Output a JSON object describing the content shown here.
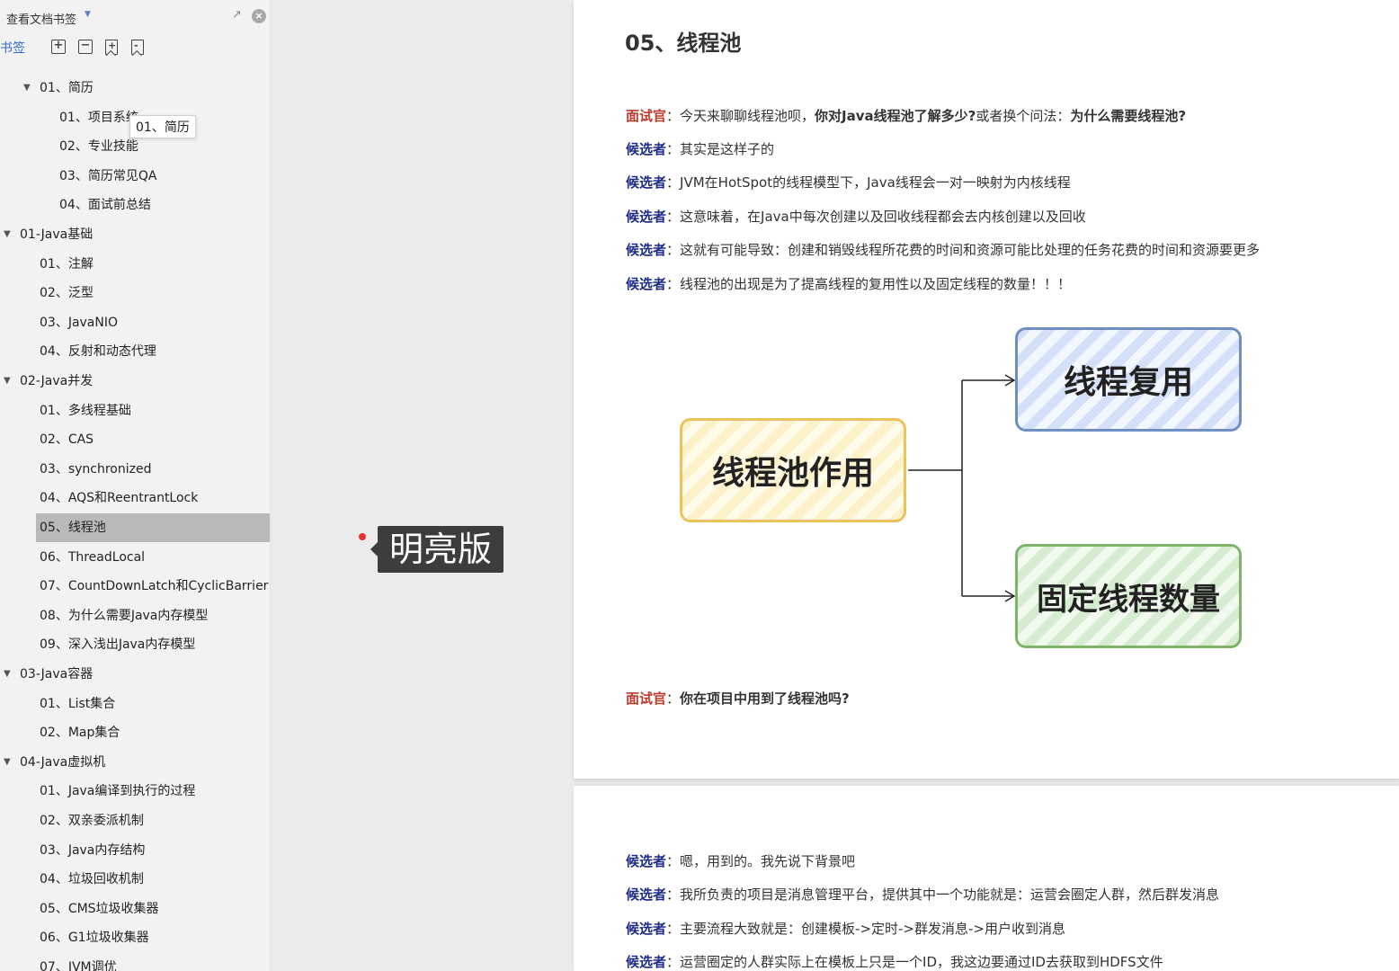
{
  "sidebar": {
    "title": "查看文档书签",
    "caret": "▼",
    "bookmarks_label": "书签",
    "tree": [
      {
        "label": "01、简历",
        "level": 1,
        "arrow": "▼"
      },
      {
        "label": "01、项目系统",
        "level": 2
      },
      {
        "label": "02、专业技能",
        "level": 2
      },
      {
        "label": "03、简历常见QA",
        "level": 2
      },
      {
        "label": "04、面试前总结",
        "level": 2
      },
      {
        "label": "01-Java基础",
        "level": 0,
        "arrow": "▼"
      },
      {
        "label": "01、注解",
        "level": 1
      },
      {
        "label": "02、泛型",
        "level": 1
      },
      {
        "label": "03、JavaNIO",
        "level": 1
      },
      {
        "label": "04、反射和动态代理",
        "level": 1
      },
      {
        "label": "02-Java并发",
        "level": 0,
        "arrow": "▼"
      },
      {
        "label": "01、多线程基础",
        "level": 1
      },
      {
        "label": "02、CAS",
        "level": 1
      },
      {
        "label": "03、synchronized",
        "level": 1
      },
      {
        "label": "04、AQS和ReentrantLock",
        "level": 1
      },
      {
        "label": "05、线程池",
        "level": 1,
        "selected": true
      },
      {
        "label": "06、ThreadLocal",
        "level": 1
      },
      {
        "label": "07、CountDownLatch和CyclicBarrier",
        "level": 1
      },
      {
        "label": "08、为什么需要Java内存模型",
        "level": 1
      },
      {
        "label": "09、深入浅出Java内存模型",
        "level": 1
      },
      {
        "label": "03-Java容器",
        "level": 0,
        "arrow": "▼"
      },
      {
        "label": "01、List集合",
        "level": 1
      },
      {
        "label": "02、Map集合",
        "level": 1
      },
      {
        "label": "04-Java虚拟机",
        "level": 0,
        "arrow": "▼"
      },
      {
        "label": "01、Java编译到执行的过程",
        "level": 1
      },
      {
        "label": "02、双亲委派机制",
        "level": 1
      },
      {
        "label": "03、Java内存结构",
        "level": 1
      },
      {
        "label": "04、垃圾回收机制",
        "level": 1
      },
      {
        "label": "05、CMS垃圾收集器",
        "level": 1
      },
      {
        "label": "06、G1垃圾收集器",
        "level": 1
      },
      {
        "label": "07、JVM调优",
        "level": 1
      }
    ],
    "tooltip": "01、简历"
  },
  "theme_badge": "明亮版",
  "page1": {
    "title": "05、线程池",
    "paragraphs": [
      {
        "speaker": "面试官",
        "role": "interviewer",
        "parts": [
          {
            "text": "今天来聊聊线程池呗，",
            "bold": false
          },
          {
            "text": "你对Java线程池了解多少?",
            "bold": true
          },
          {
            "text": "或者换个问法：",
            "bold": false
          },
          {
            "text": "为什么需要线程池?",
            "bold": true
          }
        ]
      },
      {
        "speaker": "候选者",
        "role": "candidate",
        "parts": [
          {
            "text": "其实是这样子的",
            "bold": false
          }
        ]
      },
      {
        "speaker": "候选者",
        "role": "candidate",
        "parts": [
          {
            "text": "JVM在HotSpot的线程模型下，Java线程会一对一映射为内核线程",
            "bold": false
          }
        ]
      },
      {
        "speaker": "候选者",
        "role": "candidate",
        "parts": [
          {
            "text": "这意味着，在Java中每次创建以及回收线程都会去内核创建以及回收",
            "bold": false
          }
        ]
      },
      {
        "speaker": "候选者",
        "role": "candidate",
        "parts": [
          {
            "text": "这就有可能导致：创建和销毁线程所花费的时间和资源可能比处理的任务花费的时间和资源要更多",
            "bold": false
          }
        ]
      },
      {
        "speaker": "候选者",
        "role": "candidate",
        "parts": [
          {
            "text": "线程池的出现是为了提高线程的复用性以及固定线程的数量！！！",
            "bold": false
          }
        ]
      }
    ],
    "diagram": {
      "main": "线程池作用",
      "reuse": "线程复用",
      "fixed": "固定线程数量"
    },
    "final_question": {
      "speaker": "面试官",
      "role": "interviewer",
      "text": "你在项目中用到了线程池吗?"
    }
  },
  "page2": {
    "paragraphs": [
      {
        "speaker": "候选者",
        "role": "candidate",
        "text": "嗯，用到的。我先说下背景吧"
      },
      {
        "speaker": "候选者",
        "role": "candidate",
        "text": "我所负责的项目是消息管理平台，提供其中一个功能就是：运营会圈定人群，然后群发消息"
      },
      {
        "speaker": "候选者",
        "role": "candidate",
        "text": "主要流程大致就是：创建模板->定时->群发消息->用户收到消息"
      },
      {
        "speaker": "候选者",
        "role": "candidate",
        "text": "运营圈定的人群实际上在模板上只是一个ID，我这边要通过ID去获取到HDFS文件"
      }
    ]
  }
}
